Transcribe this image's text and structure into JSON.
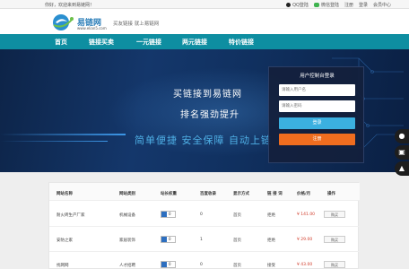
{
  "topbar": {
    "welcome": "你好，欢迎来到易链网！",
    "qq_login": "QQ登陆",
    "wechat_login": "微信登陆",
    "register": "注册",
    "login": "登录",
    "member_center": "会员中心"
  },
  "header": {
    "logo_title": "易链网",
    "logo_sub": "www.elian5.com",
    "slogan": "买友链接 就上易链网"
  },
  "nav": {
    "items": [
      "首页",
      "链接买卖",
      "一元链接",
      "两元链接",
      "特价链接"
    ]
  },
  "banner": {
    "line1": "买链接到易链网",
    "line2": "排名强劲提升",
    "line3": "简单便捷  安全保障  自动上链"
  },
  "login_panel": {
    "title": "用户控制台登录",
    "username_placeholder": "请输入用户名",
    "password_placeholder": "请输入密码",
    "login_button": "登录",
    "register_button": "注册"
  },
  "side_tools": [
    "qq-icon",
    "cart-icon",
    "top-icon"
  ],
  "table": {
    "headers": [
      "网站名称",
      "网站类别",
      "站长权重",
      "百度收录",
      "显示方式",
      "链 接 词",
      "价格/月",
      "操作"
    ],
    "rows": [
      {
        "name": "耐火砖生产厂家",
        "category": "机械设备",
        "weight": "0",
        "baidu": "0",
        "display": "首页",
        "anchor": "拒绝",
        "price": "¥ 141.00",
        "action": "购买"
      },
      {
        "name": "安防之家",
        "category": "家居装饰",
        "weight": "0",
        "baidu": "1",
        "display": "首页",
        "anchor": "拒绝",
        "price": "¥ 29.00",
        "action": "购买"
      },
      {
        "name": "找网网",
        "category": "人才招聘",
        "weight": "0",
        "baidu": "0",
        "display": "首页",
        "anchor": "接受",
        "price": "¥ 43.00",
        "action": "购买"
      }
    ]
  },
  "colors": {
    "nav_bg": "#0e8ea1",
    "login_btn": "#3bb0e0",
    "register_btn": "#f06d1f",
    "price": "#d13b2a"
  }
}
